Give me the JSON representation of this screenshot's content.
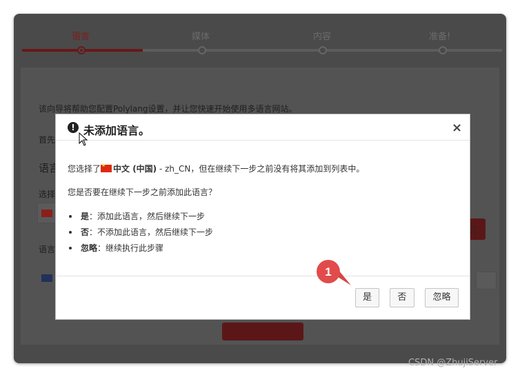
{
  "wizard": {
    "steps": [
      {
        "label": "语言",
        "active": true
      },
      {
        "label": "媒体",
        "active": false
      },
      {
        "label": "内容",
        "active": false
      },
      {
        "label": "准备!",
        "active": false
      }
    ]
  },
  "background": {
    "intro": "该向导将帮助您配置Polylang设置，并让您快速开始使用多语言网站。",
    "line2": "首先",
    "section_heading": "语言",
    "select_label": "选择",
    "add_button_label": "言",
    "language_label": "语言"
  },
  "dialog": {
    "title": "未添加语言。",
    "close_label": "×",
    "message_prefix": "您选择了",
    "language_name": "中文 (中国)",
    "message_suffix": " - zh_CN，但在继续下一步之前没有将其添加到列表中。",
    "question": "您是否要在继续下一步之前添加此语言？",
    "options": [
      {
        "term": "是",
        "desc": "：添加此语言，然后继续下一步"
      },
      {
        "term": "否",
        "desc": "：不添加此语言，然后继续下一步"
      },
      {
        "term": "忽略",
        "desc": "：继续执行此步骤"
      }
    ],
    "buttons": {
      "yes": "是",
      "no": "否",
      "ignore": "忽略"
    }
  },
  "annotation": {
    "marker_number": "1",
    "color": "#e24b4b"
  },
  "watermark": "CSDN @ZhujiServer"
}
